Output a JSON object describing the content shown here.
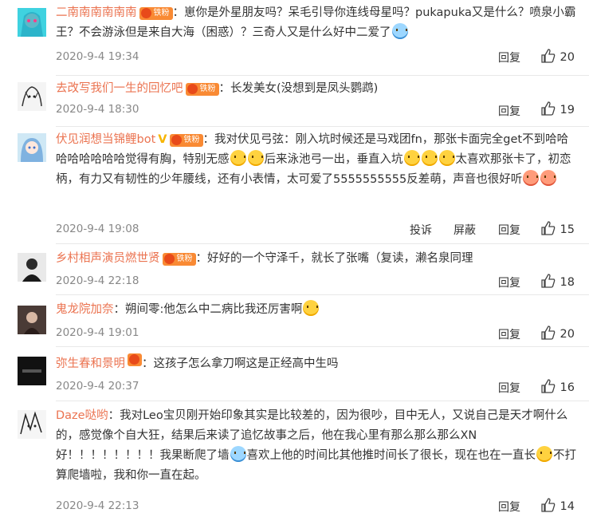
{
  "comments": [
    {
      "username": "二南南南南南南",
      "badge": "铁粉",
      "segments": [
        "：崽你是外星朋友吗？呆毛引导你连线母星吗？pukapuka又是什么？喷泉小霸王？不会游泳但是来自大海（困惑）？三奇人又是什么好中二爱了"
      ],
      "time": "2020-9-4 19:34",
      "actions": [
        "回复"
      ],
      "likes": "20"
    },
    {
      "username": "去改写我们一生的回忆吧",
      "badge": "铁粉",
      "segments": [
        "：长发美女(没想到是凤头鹦鹉)"
      ],
      "time": "2020-9-4 18:30",
      "actions": [
        "回复"
      ],
      "likes": "19"
    },
    {
      "username": "伏见润想当锦鲤bot",
      "badge": "铁粉",
      "segments": [
        "：我对伏见弓弦：刚入坑时候还是马戏团fn，那张卡面完全get不到哈哈哈哈哈哈哈哈觉得有胸，特别无感",
        "后来泳池弓一出，垂直入坑",
        "太喜欢那张卡了，初恋柄，有力又有韧性的少年腰线，还有小表情，太可爱了5555555555反差萌，声音也很好听"
      ],
      "time": "2020-9-4 19:08",
      "actions": [
        "投诉",
        "屏蔽",
        "回复"
      ],
      "likes": "15"
    },
    {
      "username": "乡村相声演员燃世贤",
      "badge": "铁粉",
      "segments": [
        "：好好的一个守泽千，就长了张嘴（复读，濑名泉同理"
      ],
      "time": "2020-9-4 22:18",
      "actions": [
        "回复"
      ],
      "likes": "18"
    },
    {
      "username": "鬼龙院加奈",
      "badge": "",
      "segments": [
        "：朔间零:他怎么中二病比我还厉害啊"
      ],
      "time": "2020-9-4 19:01",
      "actions": [
        "回复"
      ],
      "likes": "20"
    },
    {
      "username": "弥生春和景明",
      "badge": "",
      "segments": [
        "：这孩子怎么拿刀啊这是正经高中生吗"
      ],
      "time": "2020-9-4 20:37",
      "actions": [
        "回复"
      ],
      "likes": "16"
    },
    {
      "username": "Daze哒哟",
      "badge": "",
      "segments": [
        "：我对Leo宝贝刚开始印象其实是比较差的，因为很吵，目中无人，又说自己是天才啊什么的，感觉像个自大狂，结果后来读了追忆故事之后，他在我心里有那么那么那么XN好！！！！！！！！我果断爬了墙",
        "喜欢上他的时间比其他推时间长了很长，现在也在一直长",
        "不打算爬墙啦，我和你一直在起。"
      ],
      "time": "2020-9-4 22:13",
      "actions": [
        "回复"
      ],
      "likes": "14"
    }
  ],
  "colors": {
    "username": "#eb7350",
    "meta": "#888888",
    "badge": "#f98a34"
  }
}
